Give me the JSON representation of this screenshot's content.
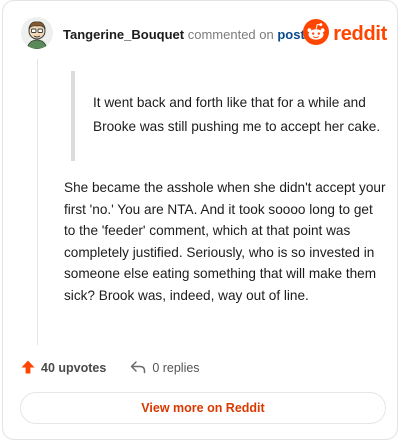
{
  "header": {
    "author": "Tangerine_Bouquet",
    "action_text": "commented on",
    "post_link": "post",
    "brand": "reddit"
  },
  "comment": {
    "quote": "It went back and forth like that for a while and Brooke was still pushing me to accept her cake.",
    "body": "She became the asshole when she didn't accept your first 'no.' You are NTA. And it took soooo long to get to the 'feeder' comment, which at that point was completely justified. Seriously, who is so invested in someone else eating something that will make them sick? Brook was, indeed, way out of line."
  },
  "actions": {
    "upvotes": "40 upvotes",
    "replies": "0 replies"
  },
  "footer": {
    "view_more": "View more on Reddit"
  },
  "colors": {
    "brand": "#ff4500",
    "upvote_arrow": "#ff4500",
    "link": "#0a4a8c",
    "view_more_text": "#d93900"
  },
  "icons": {
    "avatar": "snoo-avatar-icon",
    "brand": "reddit-logo-icon",
    "upvote": "upvote-arrow-icon",
    "reply": "reply-arrow-icon"
  }
}
